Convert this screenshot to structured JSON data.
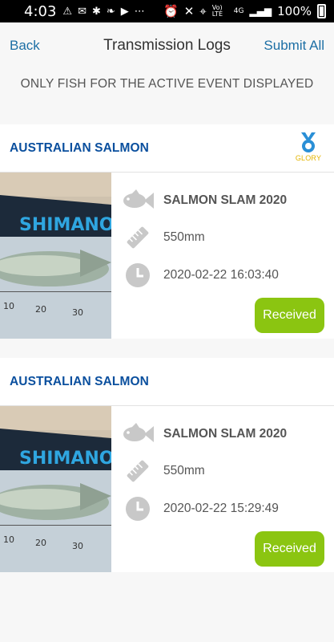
{
  "status_bar": {
    "time": "4:03",
    "battery": "100%",
    "network": "4G",
    "lte": "Vo) LTE"
  },
  "nav": {
    "back_label": "Back",
    "title": "Transmission Logs",
    "submit_label": "Submit All"
  },
  "notice": "ONLY FISH FOR THE ACTIVE EVENT DISPLAYED",
  "entries": [
    {
      "species": "AUSTRALIAN SALMON",
      "badge": "GLORY",
      "event": "SALMON SLAM 2020",
      "length": "550mm",
      "datetime": "2020-02-22 16:03:40",
      "status": "Received",
      "photo_brand": "SHIMANO",
      "ruler_labels": [
        "10",
        "20",
        "30"
      ]
    },
    {
      "species": "AUSTRALIAN SALMON",
      "event": "SALMON SLAM 2020",
      "length": "550mm",
      "datetime": "2020-02-22 15:29:49",
      "status": "Received",
      "photo_brand": "SHIMANO",
      "ruler_labels": [
        "10",
        "20",
        "30"
      ]
    }
  ],
  "colors": {
    "link": "#1d6fa5",
    "species": "#0a4f9e",
    "received": "#8bc511",
    "icon_grey": "#c8c8c8",
    "badge_blue": "#2a8fd6",
    "badge_gold": "#e3b400"
  },
  "icons": {
    "event": "fish-icon",
    "length": "ruler-icon",
    "time": "clock-icon",
    "badge": "medal-icon"
  }
}
